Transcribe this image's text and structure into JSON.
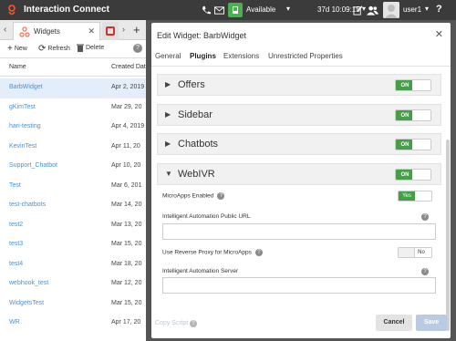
{
  "app": {
    "title": "Interaction Connect"
  },
  "topbar": {
    "status": "Available",
    "timer": "37d 10:09:15",
    "user": "user1",
    "help": "?"
  },
  "left": {
    "tab_label": "Widgets",
    "toolbar": {
      "new": "New",
      "refresh": "Refresh",
      "delete": "Delete"
    },
    "columns": {
      "name": "Name",
      "created": "Created Dat"
    },
    "rows": [
      {
        "name": "BarbWidget",
        "date": "Apr 2, 2019",
        "selected": true
      },
      {
        "name": "gKimTest",
        "date": "Mar 29, 20"
      },
      {
        "name": "hari-testing",
        "date": "Apr 4, 2019"
      },
      {
        "name": "KevinTest",
        "date": "Apr 11, 20"
      },
      {
        "name": "Support_Chatbot",
        "date": "Apr 10, 20"
      },
      {
        "name": "Test",
        "date": "Mar 6, 201"
      },
      {
        "name": "test-chatbots",
        "date": "Mar 14, 20"
      },
      {
        "name": "test2",
        "date": "Mar 13, 20"
      },
      {
        "name": "test3",
        "date": "Mar 15, 20"
      },
      {
        "name": "test4",
        "date": "Mar 18, 20"
      },
      {
        "name": "webhook_test",
        "date": "Mar 12, 20"
      },
      {
        "name": "WidgetsTest",
        "date": "Mar 15, 20"
      },
      {
        "name": "WR",
        "date": "Apr 17, 20"
      }
    ]
  },
  "modal": {
    "title": "Edit Widget: BarbWidget",
    "close": "✕",
    "tabs": [
      "General",
      "Plugins",
      "Extensions",
      "Unrestricted Properties"
    ],
    "active_tab": "Plugins",
    "sections": [
      {
        "title": "Offers",
        "toggle": "ON",
        "expanded": false
      },
      {
        "title": "Sidebar",
        "toggle": "ON",
        "expanded": false
      },
      {
        "title": "Chatbots",
        "toggle": "ON",
        "expanded": false
      },
      {
        "title": "WebIVR",
        "toggle": "ON",
        "expanded": true
      }
    ],
    "webivr": {
      "microapps_label": "MicroApps Enabled",
      "microapps_value": "Yes",
      "public_url_label": "Intelligent Automation Public URL",
      "public_url_value": "",
      "reverse_proxy_label": "Use Reverse Proxy for MicroApps",
      "reverse_proxy_value": "No",
      "server_label": "Intelligent Automation Server",
      "server_value": ""
    },
    "footer": {
      "copy_script": "Copy Script",
      "cancel": "Cancel",
      "save": "Save"
    }
  },
  "colors": {
    "accent_green": "#43a047",
    "link_blue": "#4a90d9",
    "topbar": "#3b3b3b"
  }
}
